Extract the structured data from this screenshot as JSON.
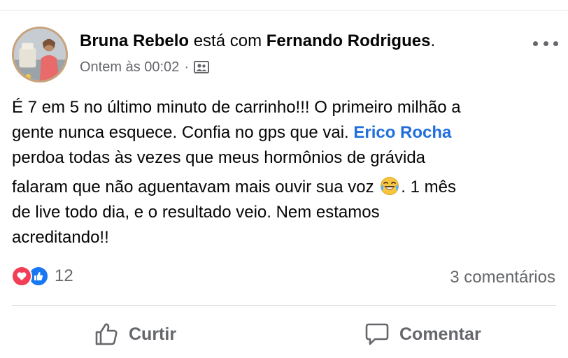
{
  "post": {
    "author": "Bruna Rebelo",
    "with_text": " está com ",
    "tagged_person": "Fernando Rodrigues",
    "period": ".",
    "timestamp": "Ontem às 00:02",
    "separator": "·",
    "audience_icon": "friends-except-icon",
    "text": {
      "line1": "É 7 em 5 no último minuto de carrinho!!! O primeiro milhão a",
      "line2_a": "gente nunca esquece. Confia no gps que vai. ",
      "line2_tag": "Erico Rocha",
      "line3": "perdoa todas às vezes que meus hormônios de grávida",
      "line4_a": "falaram  que não aguentavam mais ouvir sua voz ",
      "line4_emoji": "face-with-tears-of-joy",
      "line4_b": ". 1 mês",
      "line5": "de live todo dia, e o resultado veio. Nem estamos",
      "line6": "acreditando!!"
    }
  },
  "reactions": {
    "types": [
      "love",
      "like"
    ],
    "count": "12"
  },
  "comments": {
    "count_label": "3 comentários"
  },
  "actions": {
    "like_label": "Curtir",
    "comment_label": "Comentar"
  },
  "colors": {
    "tag_link": "#216fdb",
    "secondary_text": "#65676b",
    "love": "#f33e58",
    "like": "#1877f2"
  }
}
